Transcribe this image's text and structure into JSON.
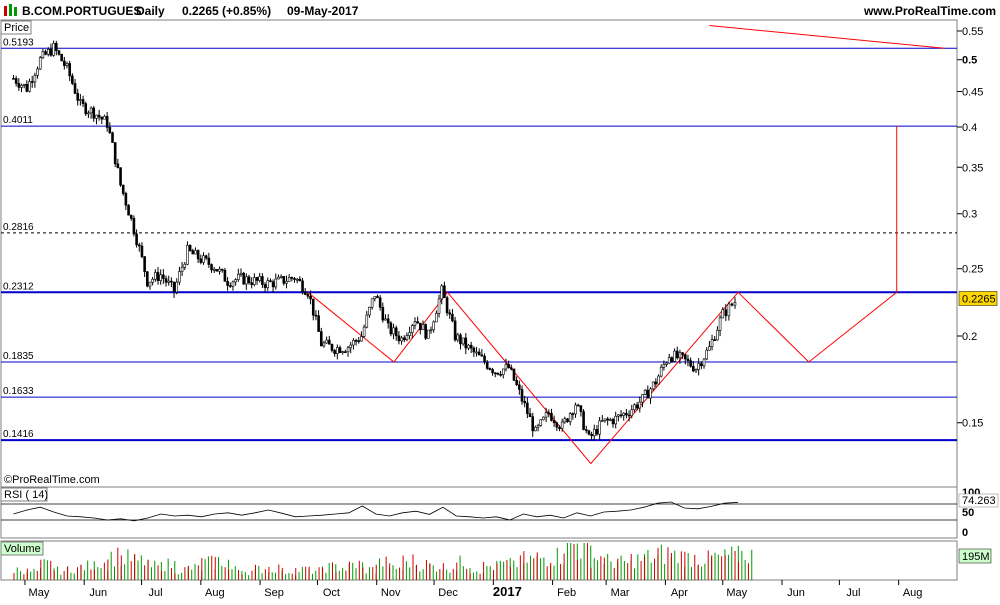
{
  "header": {
    "symbol": "B.COM.PORTUGUES",
    "period": "Daily",
    "last": "0.2265 (+0.85%)",
    "date": "09-May-2017",
    "site": "www.ProRealTime.com"
  },
  "watermark": "©ProRealTime.com",
  "colors": {
    "background": "#ffffff",
    "frame": "#7f7f7f",
    "level_line": "#0000cc",
    "pattern": "#ff0000",
    "candle": "#000000",
    "rsi_line": "#000000",
    "volume_bar": "#009900",
    "volume_bar_alt": "#cc0000",
    "price_tag": "#ffd700",
    "volume_tag": "#ccffcc"
  },
  "chart_data": [
    {
      "type": "candlestick",
      "panel": "price",
      "label": "Price",
      "scale": "log",
      "x_labels": [
        "May",
        "Jun",
        "Jul",
        "Aug",
        "Sep",
        "Oct",
        "Nov",
        "Dec",
        "2017",
        "Feb",
        "Mar",
        "Apr",
        "May",
        "Jun",
        "Jul",
        "Aug"
      ],
      "y_ticks": [
        "0.55",
        "0.5",
        "0.45",
        "0.4",
        "0.35",
        "0.3",
        "0.25",
        "0.2",
        "0.15"
      ],
      "y_ticks_bold": [
        "0.5"
      ],
      "last_price": "0.2265",
      "levels": [
        {
          "label": "0.5193",
          "value": 0.5193,
          "style": "solid"
        },
        {
          "label": "0.4011",
          "value": 0.4011,
          "style": "solid"
        },
        {
          "label": "0.2816",
          "value": 0.2816,
          "style": "dashed"
        },
        {
          "label": "0.2312",
          "value": 0.2312,
          "style": "bold"
        },
        {
          "label": "0.1835",
          "value": 0.1835,
          "style": "solid"
        },
        {
          "label": "0.1633",
          "value": 0.1633,
          "style": "solid"
        },
        {
          "label": "0.1416",
          "value": 0.1416,
          "style": "bold"
        }
      ],
      "series_points": [
        {
          "date": "2016-04-25",
          "close": 0.47
        },
        {
          "date": "2016-05-02",
          "close": 0.455
        },
        {
          "date": "2016-05-09",
          "close": 0.5
        },
        {
          "date": "2016-05-16",
          "close": 0.52
        },
        {
          "date": "2016-05-23",
          "close": 0.485
        },
        {
          "date": "2016-05-30",
          "close": 0.43
        },
        {
          "date": "2016-06-06",
          "close": 0.42
        },
        {
          "date": "2016-06-13",
          "close": 0.405
        },
        {
          "date": "2016-06-20",
          "close": 0.33
        },
        {
          "date": "2016-06-27",
          "close": 0.285
        },
        {
          "date": "2016-07-04",
          "close": 0.24
        },
        {
          "date": "2016-07-11",
          "close": 0.245
        },
        {
          "date": "2016-07-18",
          "close": 0.232
        },
        {
          "date": "2016-07-25",
          "close": 0.265
        },
        {
          "date": "2016-08-01",
          "close": 0.258
        },
        {
          "date": "2016-08-08",
          "close": 0.252
        },
        {
          "date": "2016-08-15",
          "close": 0.24
        },
        {
          "date": "2016-08-22",
          "close": 0.242
        },
        {
          "date": "2016-08-29",
          "close": 0.24
        },
        {
          "date": "2016-09-05",
          "close": 0.238
        },
        {
          "date": "2016-09-12",
          "close": 0.24
        },
        {
          "date": "2016-09-19",
          "close": 0.243
        },
        {
          "date": "2016-09-26",
          "close": 0.232
        },
        {
          "date": "2016-10-03",
          "close": 0.195
        },
        {
          "date": "2016-10-10",
          "close": 0.192
        },
        {
          "date": "2016-10-17",
          "close": 0.193
        },
        {
          "date": "2016-10-24",
          "close": 0.2
        },
        {
          "date": "2016-10-31",
          "close": 0.23
        },
        {
          "date": "2016-11-07",
          "close": 0.205
        },
        {
          "date": "2016-11-14",
          "close": 0.198
        },
        {
          "date": "2016-11-21",
          "close": 0.212
        },
        {
          "date": "2016-11-28",
          "close": 0.2
        },
        {
          "date": "2016-12-05",
          "close": 0.232
        },
        {
          "date": "2016-12-12",
          "close": 0.2
        },
        {
          "date": "2016-12-19",
          "close": 0.192
        },
        {
          "date": "2016-12-26",
          "close": 0.185
        },
        {
          "date": "2017-01-02",
          "close": 0.178
        },
        {
          "date": "2017-01-09",
          "close": 0.18
        },
        {
          "date": "2017-01-16",
          "close": 0.162
        },
        {
          "date": "2017-01-23",
          "close": 0.145
        },
        {
          "date": "2017-01-30",
          "close": 0.155
        },
        {
          "date": "2017-02-06",
          "close": 0.148
        },
        {
          "date": "2017-02-13",
          "close": 0.16
        },
        {
          "date": "2017-02-20",
          "close": 0.142
        },
        {
          "date": "2017-02-27",
          "close": 0.15
        },
        {
          "date": "2017-03-06",
          "close": 0.152
        },
        {
          "date": "2017-03-13",
          "close": 0.156
        },
        {
          "date": "2017-03-20",
          "close": 0.162
        },
        {
          "date": "2017-03-27",
          "close": 0.172
        },
        {
          "date": "2017-04-03",
          "close": 0.188
        },
        {
          "date": "2017-04-10",
          "close": 0.185
        },
        {
          "date": "2017-04-17",
          "close": 0.18
        },
        {
          "date": "2017-04-24",
          "close": 0.192
        },
        {
          "date": "2017-05-01",
          "close": 0.215
        },
        {
          "date": "2017-05-09",
          "close": 0.2265
        }
      ],
      "pattern_path": [
        {
          "date": "2016-09-26",
          "value": 0.2312
        },
        {
          "date": "2016-11-10",
          "value": 0.1835
        },
        {
          "date": "2016-12-08",
          "value": 0.2312
        },
        {
          "date": "2017-02-21",
          "value": 0.131
        },
        {
          "date": "2017-05-09",
          "value": 0.2312
        },
        {
          "date": "2017-06-15",
          "value": 0.1835
        },
        {
          "date": "2017-07-31",
          "value": 0.2312
        }
      ],
      "target_line": {
        "date": "2017-07-31",
        "from": 0.2312,
        "to": 0.4011
      },
      "trend_line": {
        "from": {
          "date": "2017-04-24",
          "value": 0.56
        },
        "to": {
          "date": "2017-08-25",
          "value": 0.5193
        }
      }
    },
    {
      "type": "line",
      "panel": "rsi",
      "label": "RSI ( 14)",
      "y_ticks": [
        "100",
        "50",
        "0"
      ],
      "levels": [
        70,
        30
      ],
      "ylim": [
        0,
        100
      ],
      "last_value": "74.263",
      "values": [
        45,
        55,
        62,
        50,
        40,
        38,
        35,
        30,
        33,
        28,
        35,
        45,
        40,
        42,
        38,
        45,
        48,
        42,
        48,
        55,
        47,
        38,
        40,
        42,
        45,
        48,
        65,
        45,
        40,
        48,
        52,
        44,
        62,
        40,
        38,
        35,
        38,
        30,
        45,
        38,
        42,
        35,
        48,
        40,
        50,
        52,
        55,
        62,
        72,
        75,
        60,
        58,
        64,
        72,
        74.263
      ]
    },
    {
      "type": "bar",
      "panel": "volume",
      "label": "Volume",
      "last_value": "195M",
      "values": [
        12,
        10,
        18,
        11,
        14,
        16,
        20,
        28,
        25,
        22,
        16,
        18,
        12,
        14,
        20,
        22,
        12,
        10,
        13,
        14,
        10,
        12,
        11,
        15,
        14,
        18,
        12,
        20,
        14,
        22,
        18,
        16,
        15,
        20,
        12,
        16,
        18,
        20,
        24,
        26,
        28,
        42,
        35,
        26,
        22,
        20,
        24,
        26,
        30,
        28,
        26,
        24,
        26,
        28,
        30
      ]
    }
  ]
}
